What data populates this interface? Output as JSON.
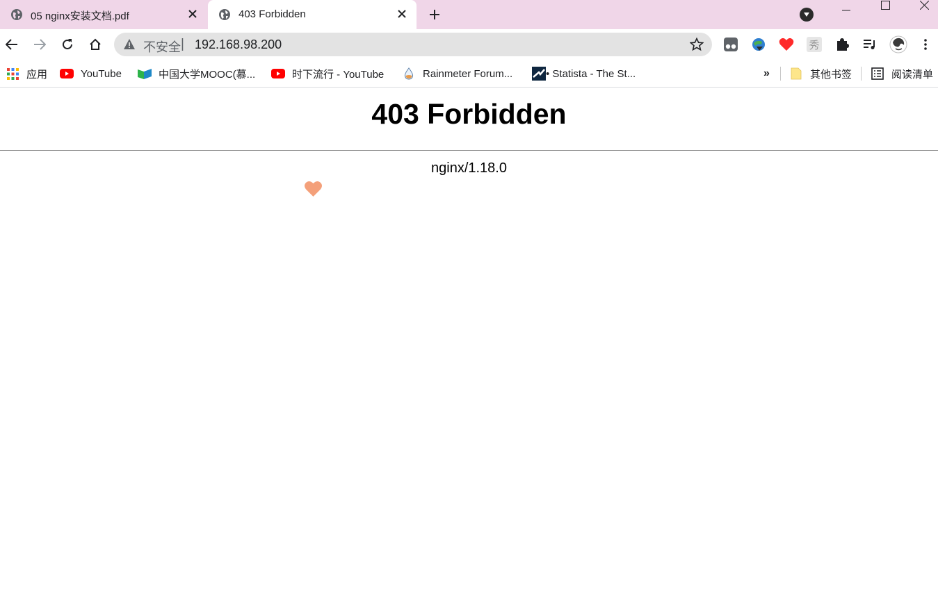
{
  "tabs": [
    {
      "title": "05 nginx安装文档.pdf",
      "active": false,
      "icon": "globe-icon"
    },
    {
      "title": "403 Forbidden",
      "active": true,
      "icon": "globe-icon"
    }
  ],
  "omnibox": {
    "security_label": "不安全",
    "separator": "|",
    "url": "192.168.98.200"
  },
  "bookmarks": [
    {
      "label": "应用",
      "icon": "apps-grid-icon"
    },
    {
      "label": "YouTube",
      "icon": "youtube-icon"
    },
    {
      "label": "中国大学MOOC(慕...",
      "icon": "mooc-icon"
    },
    {
      "label": "时下流行 - YouTube",
      "icon": "youtube-icon"
    },
    {
      "label": "Rainmeter Forum...",
      "icon": "rainmeter-drop-icon"
    },
    {
      "label": "• Statista - The St...",
      "icon": "statista-icon"
    }
  ],
  "bookmarks_overflow": "»",
  "other_bookmarks": "其他书签",
  "reading_list": "阅读清单",
  "page": {
    "heading": "403 Forbidden",
    "server": "nginx/1.18.0"
  },
  "colors": {
    "tabstrip": "#f0d6e8",
    "omnibox": "#e3e3e3",
    "heart": "#f4a07a",
    "youtube": "#ff0000"
  }
}
